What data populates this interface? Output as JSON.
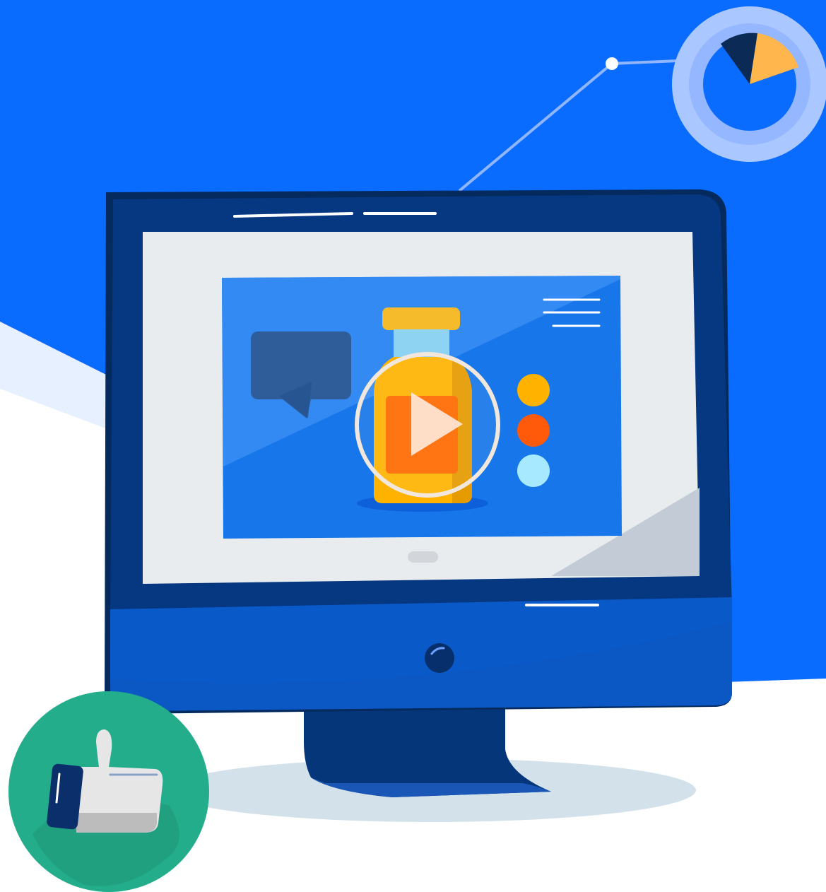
{
  "scene": {
    "description_free": true,
    "colors": {
      "background_blue": "#0a6bff",
      "light_band": "#e6f0ff",
      "monitor_dark": "#04306e",
      "monitor_body": "#0a59c8",
      "screen_frame": "#e9ecef",
      "video_area": "#1676ea",
      "bottle_cap": "#f6bb2a",
      "bottle_body": "#ffb300",
      "bottle_label": "#ff6a00",
      "dot_yellow": "#ffb300",
      "dot_orange": "#ff5a0a",
      "dot_cyan": "#a7e9ff",
      "chat_bubble": "#2f5d9a",
      "donut_ring": "#93b8ff",
      "donut_slice_orange": "#ffb74d",
      "donut_slice_dark": "#0b2a55",
      "like_circle": "#21a382",
      "thumb_light": "#e6e6e6",
      "thumb_cuff": "#0b2f6b",
      "shadow": "#d3e1ea"
    },
    "icons": {
      "play": "play-icon",
      "thumbs_up": "thumbs-up-icon",
      "pie": "pie-chart-icon",
      "chat": "chat-bubble-icon",
      "bottle": "bottle-icon",
      "monitor": "monitor-icon"
    }
  }
}
